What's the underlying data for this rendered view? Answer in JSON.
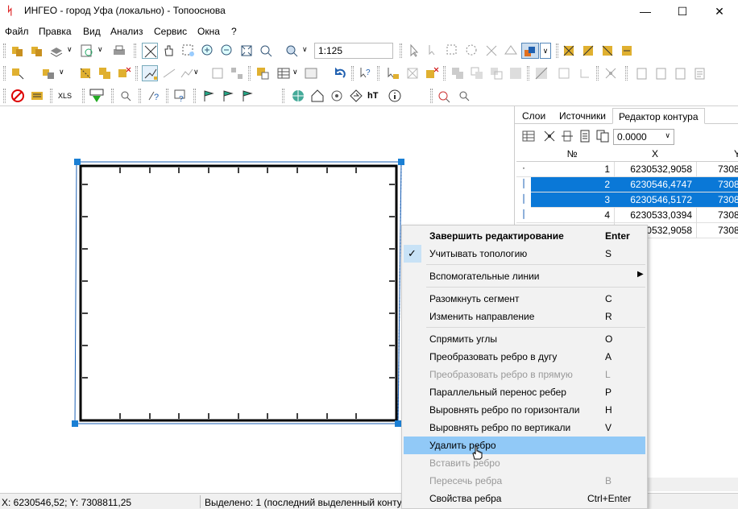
{
  "window": {
    "title": "ИНГЕО - город Уфа (локально) - Топооснова"
  },
  "menu": [
    "Файл",
    "Правка",
    "Вид",
    "Анализ",
    "Сервис",
    "Окна",
    "?"
  ],
  "toolbar": {
    "scale_value": "1:125"
  },
  "panel": {
    "tabs": [
      "Слои",
      "Источники",
      "Редактор контура"
    ],
    "tolerance": "0.0000",
    "columns": {
      "n": "№",
      "x": "X",
      "y": "Y"
    },
    "rows": [
      {
        "n": "1",
        "x": "6230532,9058",
        "y": "7308",
        "selected": false
      },
      {
        "n": "2",
        "x": "6230546,4747",
        "y": "7308",
        "selected": true
      },
      {
        "n": "3",
        "x": "6230546,5172",
        "y": "7308",
        "selected": true
      },
      {
        "n": "4",
        "x": "6230533,0394",
        "y": "7308",
        "selected": false
      },
      {
        "n": "",
        "x": "30532,9058",
        "y": "7308",
        "selected": false
      }
    ]
  },
  "context_menu": {
    "items": [
      {
        "label": "Завершить редактирование",
        "key": "Enter",
        "bold": true
      },
      {
        "label": "Учитывать топологию",
        "key": "S",
        "checked": true
      },
      {
        "label": "Вспомогательные линии",
        "submenu": true
      },
      {
        "label": "Разомкнуть сегмент",
        "key": "C"
      },
      {
        "label": "Изменить направление",
        "key": "R"
      },
      {
        "label": "Спрямить углы",
        "key": "O"
      },
      {
        "label": "Преобразовать ребро в дугу",
        "key": "A"
      },
      {
        "label": "Преобразовать ребро в прямую",
        "key": "L",
        "disabled": true
      },
      {
        "label": "Параллельный перенос ребер",
        "key": "P"
      },
      {
        "label": "Выровнять ребро по горизонтали",
        "key": "H"
      },
      {
        "label": "Выровнять ребро по вертикали",
        "key": "V"
      },
      {
        "label": "Удалить ребро",
        "key": "",
        "highlighted": true
      },
      {
        "label": "Вставить ребро",
        "key": "",
        "disabled": true
      },
      {
        "label": "Пересечь ребра",
        "key": "B",
        "disabled": true
      },
      {
        "label": "Свойства ребра",
        "key": "Ctrl+Enter"
      }
    ]
  },
  "status": {
    "coords": "X: 6230546,52; Y: 7308811,25",
    "selection": "Выделено: 1 (последний выделенный контур"
  }
}
